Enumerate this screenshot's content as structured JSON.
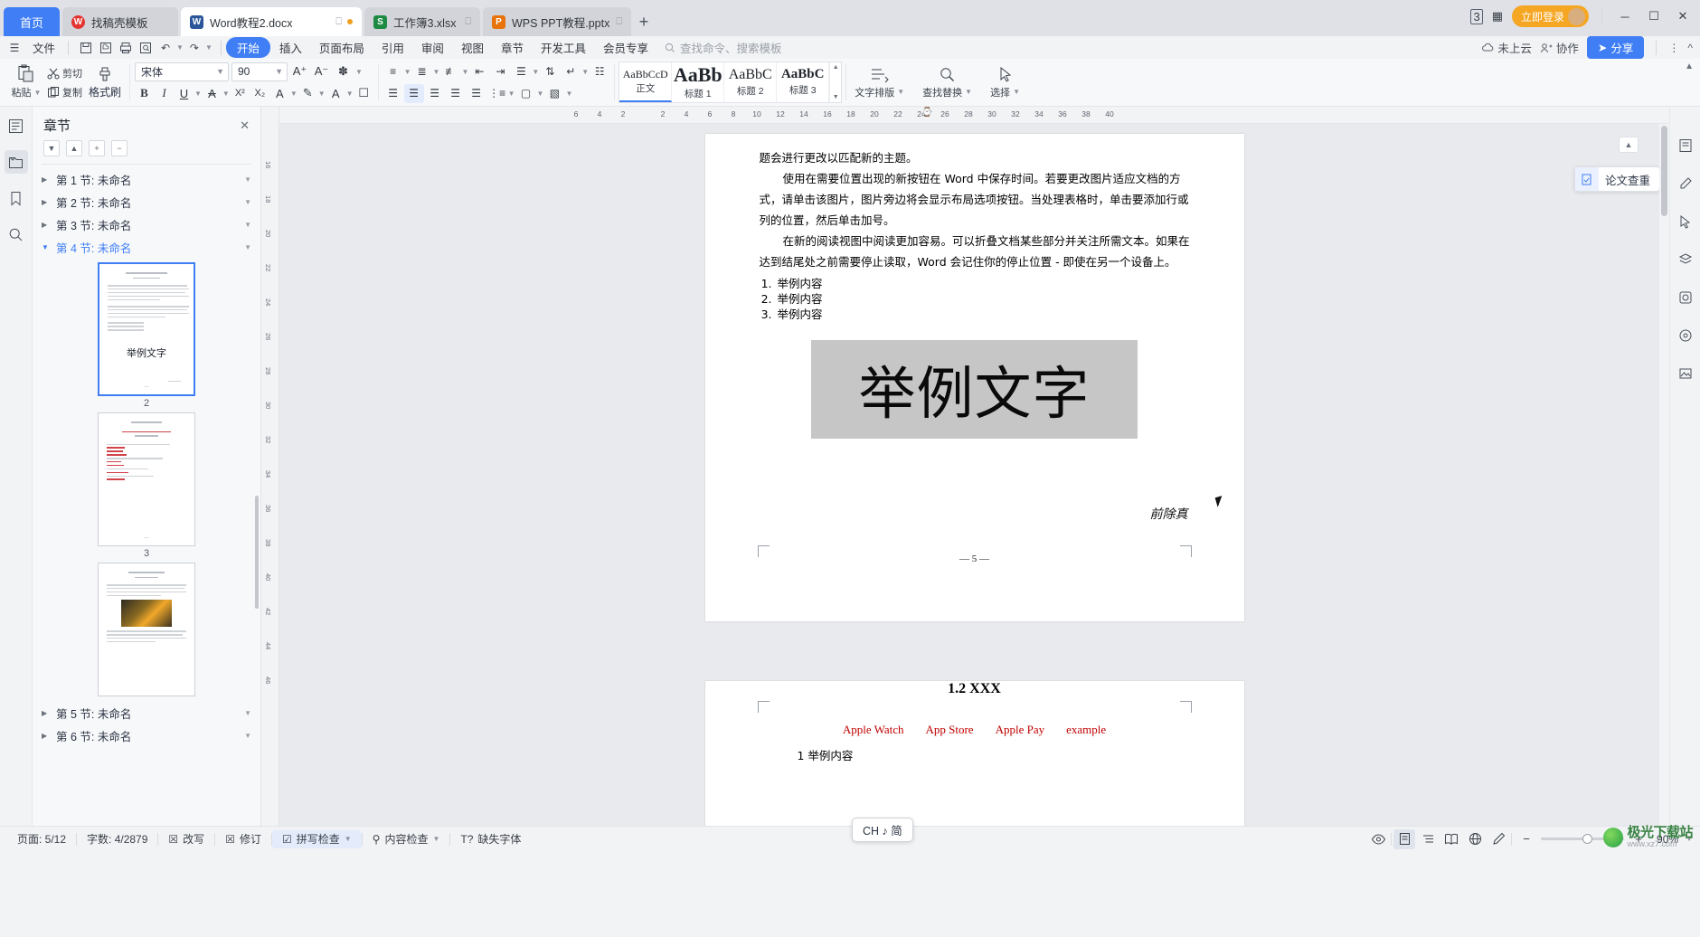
{
  "window": {
    "home_tab": "首页",
    "tabs": [
      {
        "label": "找稿壳模板",
        "icon": "wps-red-icon",
        "active": false
      },
      {
        "label": "Word教程2.docx",
        "icon": "word-blue-icon",
        "active": true,
        "unsaved": true
      },
      {
        "label": "工作簿3.xlsx",
        "icon": "excel-green-icon",
        "active": false
      },
      {
        "label": "WPS PPT教程.pptx",
        "icon": "ppt-orange-icon",
        "active": false
      }
    ],
    "new_tab": "+",
    "login_label": "立即登录",
    "minimize": "─",
    "maximize": "☐",
    "close": "✕"
  },
  "menu": {
    "file": "文件",
    "items": [
      "开始",
      "插入",
      "页面布局",
      "引用",
      "审阅",
      "视图",
      "章节",
      "开发工具",
      "会员专享"
    ],
    "selected": "开始",
    "search_placeholder": "查找命令、搜索模板",
    "cloud_label": "未上云",
    "collab_label": "协作",
    "share_label": "分享"
  },
  "ribbon": {
    "paste": "粘贴",
    "cut": "剪切",
    "copy": "复制",
    "format_painter": "格式刷",
    "font_name": "宋体",
    "font_size": "90",
    "styles": [
      {
        "preview": "AaBbCcD",
        "name": "正文",
        "size": "12px",
        "weight": "normal",
        "selected": true
      },
      {
        "preview": "AaBb",
        "name": "标题 1",
        "size": "22px",
        "weight": "bold",
        "selected": false
      },
      {
        "preview": "AaBbC",
        "name": "标题 2",
        "size": "16px",
        "weight": "normal",
        "selected": false
      },
      {
        "preview": "AaBbC",
        "name": "标题 3",
        "size": "15px",
        "weight": "bold",
        "selected": false
      }
    ],
    "text_layout": "文字排版",
    "find_replace": "查找替换",
    "select": "选择"
  },
  "navpane": {
    "title": "章节",
    "sections": [
      {
        "label": "第 1 节: 未命名",
        "current": false,
        "expanded": false
      },
      {
        "label": "第 2 节: 未命名",
        "current": false,
        "expanded": false
      },
      {
        "label": "第 3 节: 未命名",
        "current": false,
        "expanded": false
      },
      {
        "label": "第 4 节: 未命名",
        "current": true,
        "expanded": true
      },
      {
        "label": "第 5 节: 未命名",
        "current": false,
        "expanded": false
      },
      {
        "label": "第 6 节: 未命名",
        "current": false,
        "expanded": false
      }
    ],
    "thumbnails": [
      {
        "page": "2",
        "selected": true,
        "big_text": "举例文字"
      },
      {
        "page": "3",
        "selected": false,
        "big_text": ""
      },
      {
        "page": "",
        "selected": false,
        "big_text": ""
      }
    ]
  },
  "ruler": {
    "h_ticks": [
      "6",
      "4",
      "2",
      "2",
      "4",
      "6",
      "8",
      "10",
      "12",
      "14",
      "16",
      "18",
      "20",
      "22",
      "24",
      "26",
      "28",
      "30",
      "32",
      "34",
      "36",
      "38",
      "40"
    ],
    "v_ticks": [
      "16",
      "18",
      "20",
      "22",
      "24",
      "26",
      "28",
      "30",
      "32",
      "34",
      "36",
      "38",
      "40",
      "42",
      "44",
      "46"
    ]
  },
  "document": {
    "paragraphs": [
      "题会进行更改以匹配新的主题。",
      "使用在需要位置出现的新按钮在 Word 中保存时间。若要更改图片适应文档的方式，请单击该图片，图片旁边将会显示布局选项按钮。当处理表格时，单击要添加行或列的位置，然后单击加号。",
      "在新的阅读视图中阅读更加容易。可以折叠文档某些部分并关注所需文本。如果在达到结尾处之前需要停止读取，Word 会记住你的停止位置 - 即使在另一个设备上。"
    ],
    "list_items": [
      "举例内容",
      "举例内容",
      "举例内容"
    ],
    "selected_text": "举例文字",
    "handwriting": "前除真",
    "page_number_mark": "— 5 —",
    "page2_heading": "1.2 XXX",
    "page2_red_words": [
      "Apple Watch",
      "App Store",
      "Apple Pay",
      "example"
    ],
    "page2_last_line": "1 举例内容"
  },
  "float_card": {
    "label": "论文查重",
    "icon": "document-check-icon"
  },
  "status": {
    "page": "页面: 5/12",
    "words": "字数: 4/2879",
    "overwrite": "改写",
    "revision": "修订",
    "spellcheck": "拼写检查",
    "content_check": "内容检查",
    "missing_font": "缺失字体",
    "ime": "CH ♪ 简",
    "zoom": "90%",
    "zoom_minus": "−",
    "zoom_plus": "+"
  },
  "watermark": {
    "text": "极光下载站",
    "sub": "www.xz7.com"
  },
  "colors": {
    "accent": "#3f7ef5",
    "tabbar_bg": "#dfe1e6",
    "ribbon_bg": "#f7f8fa",
    "login_orange": "#f5a623",
    "doc_red": "#c00000",
    "selection_gray": "#c6c6c6"
  }
}
